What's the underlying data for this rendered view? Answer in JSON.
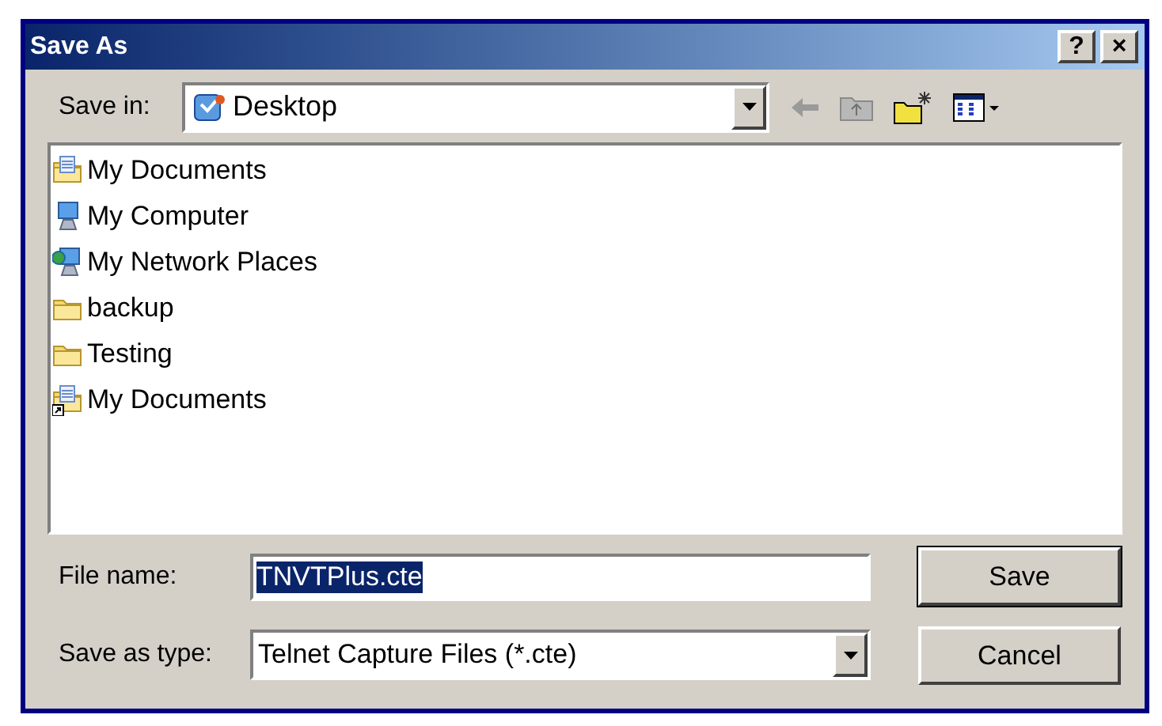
{
  "window": {
    "title": "Save As",
    "controls": [
      "?",
      "×"
    ]
  },
  "save_in": {
    "label": "Save in:",
    "value": "Desktop"
  },
  "toolbar": [
    {
      "kind": "back"
    },
    {
      "kind": "up-folder"
    },
    {
      "kind": "new-folder"
    },
    {
      "kind": "view-menu"
    }
  ],
  "files": [
    {
      "name": "My Documents",
      "kind": "documents"
    },
    {
      "name": "My Computer",
      "kind": "computer"
    },
    {
      "name": "My Network Places",
      "kind": "network"
    },
    {
      "name": "backup",
      "kind": "folder"
    },
    {
      "name": "Testing",
      "kind": "folder"
    },
    {
      "name": "My Documents",
      "kind": "shortcut"
    }
  ],
  "file_name": {
    "label": "File name:",
    "value": "TNVTPlus.cte",
    "text_selected": true
  },
  "save_as_type": {
    "label": "Save as type:",
    "value": "Telnet Capture Files (*.cte)"
  },
  "buttons": [
    {
      "label": "Save",
      "default": true
    },
    {
      "label": "Cancel",
      "default": false
    }
  ]
}
